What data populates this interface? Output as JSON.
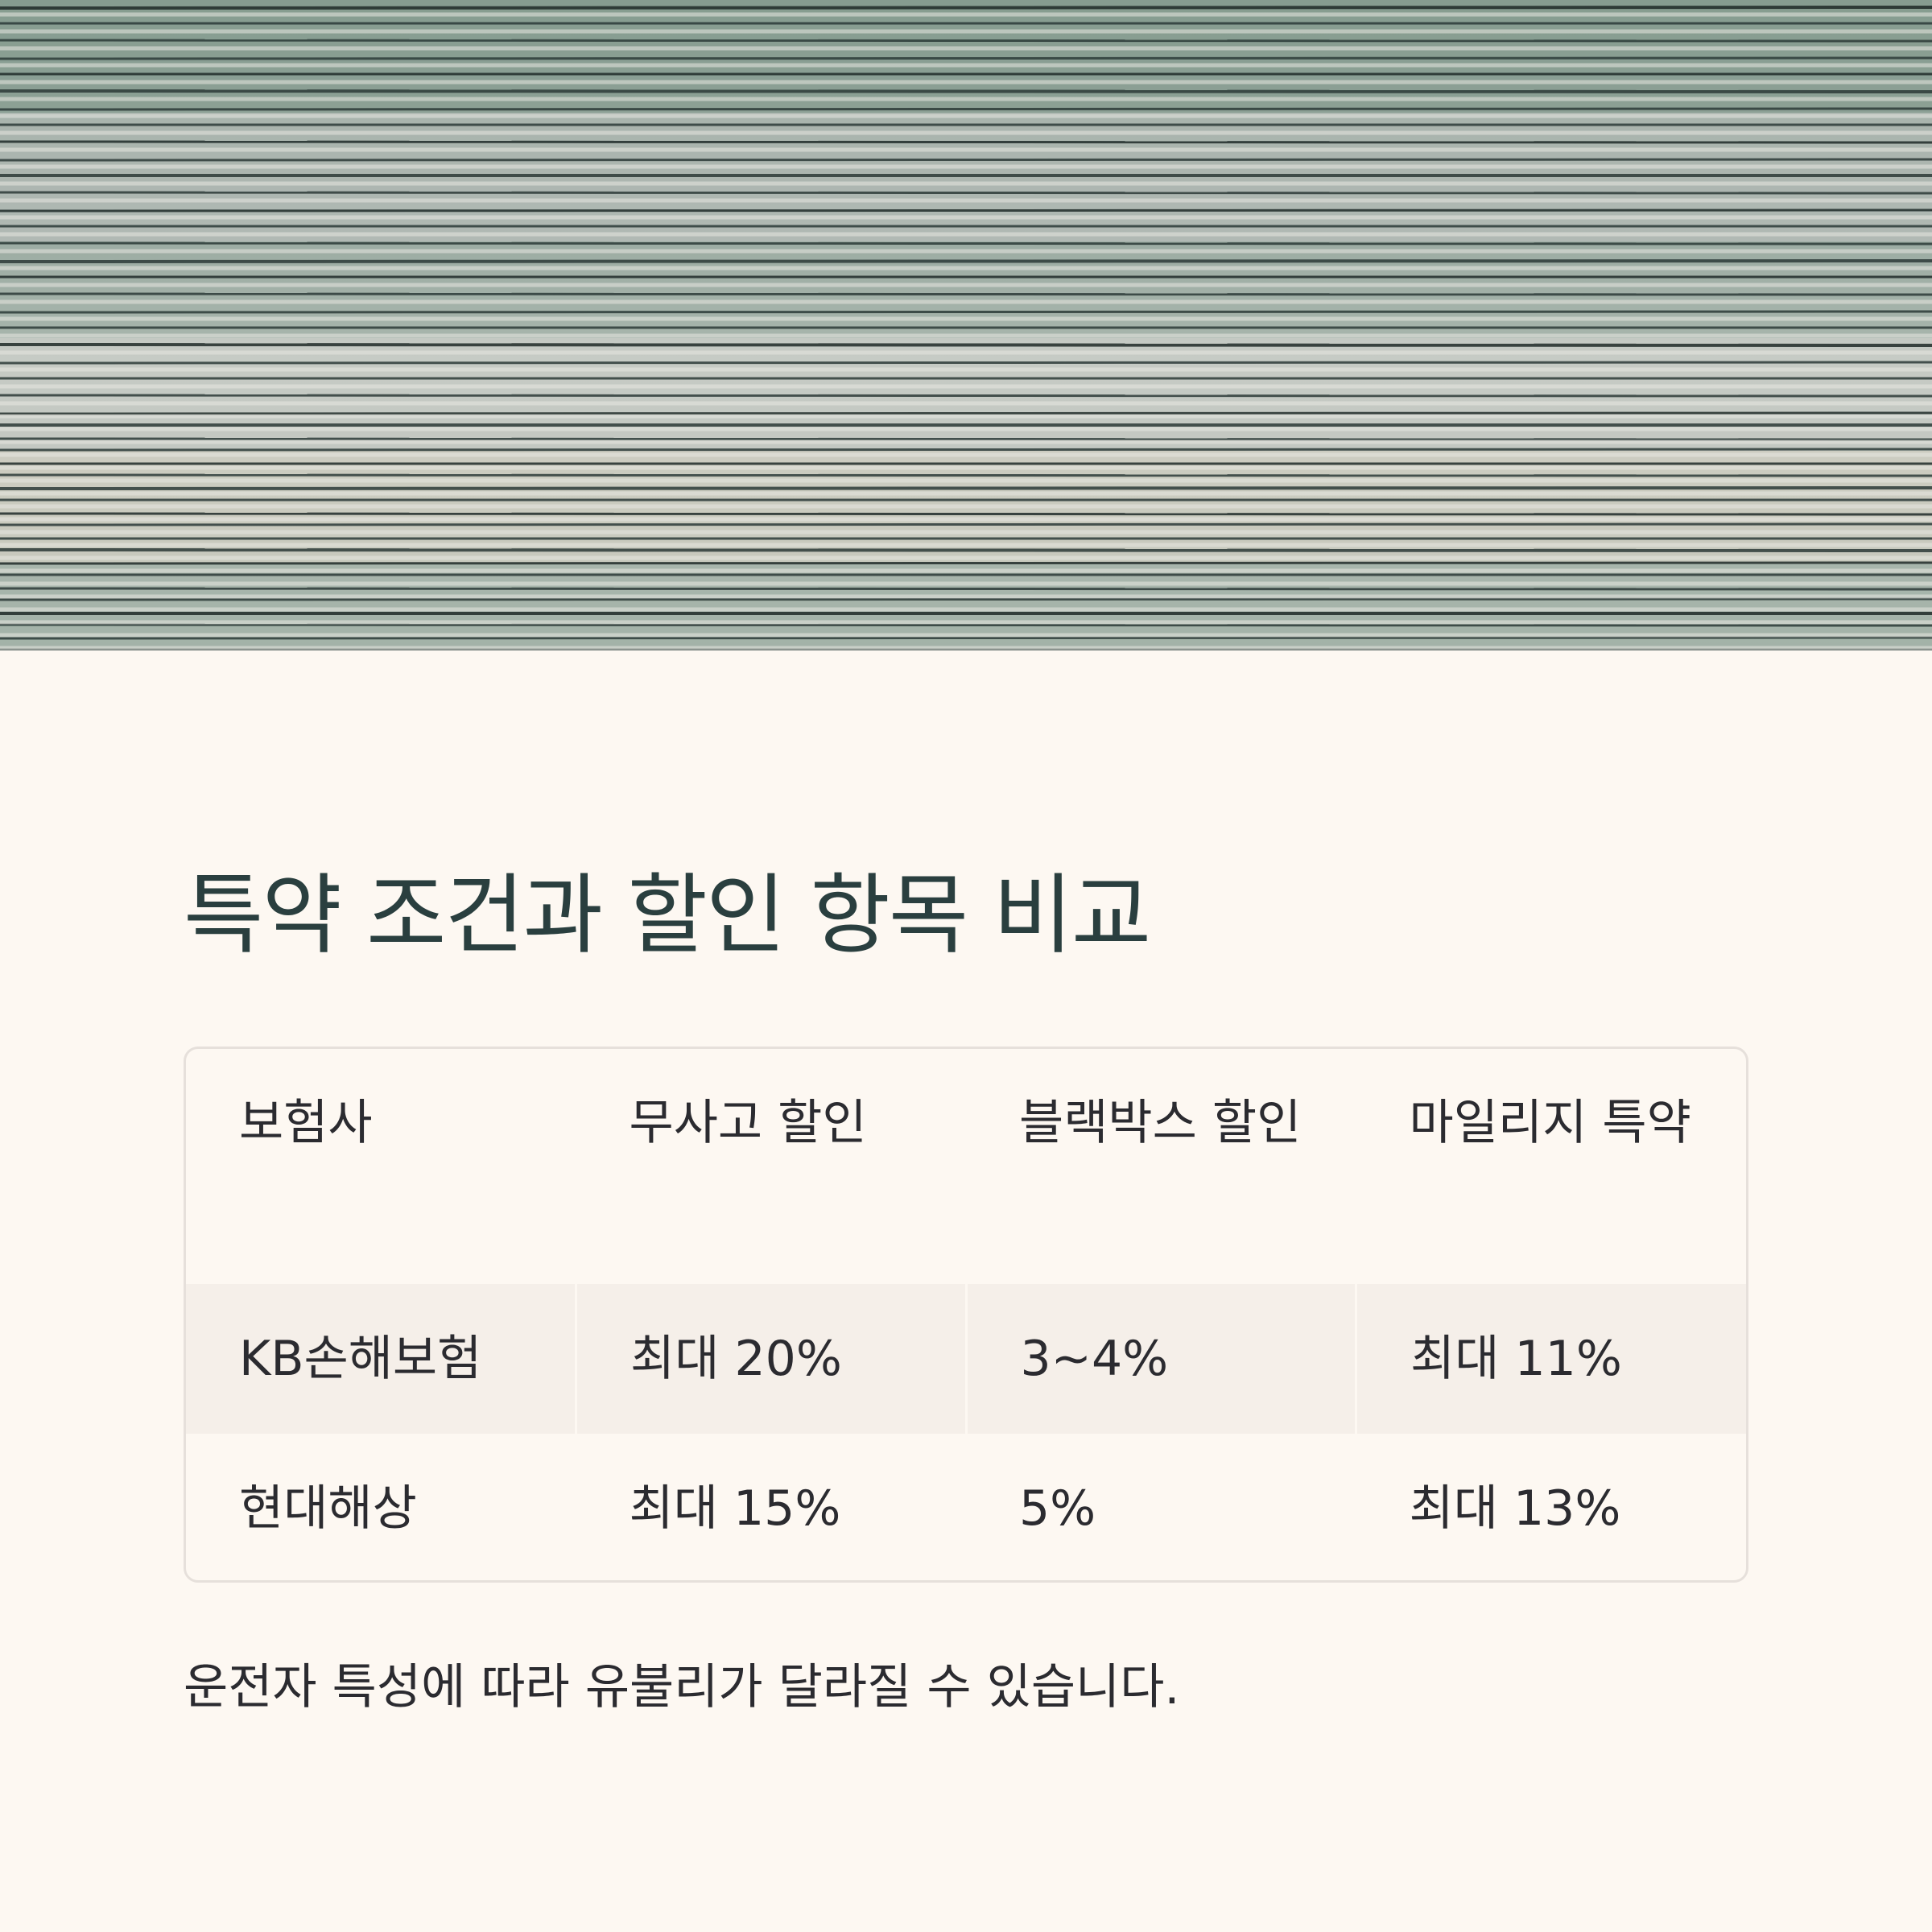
{
  "title": "특약 조건과 할인 항목 비교",
  "table": {
    "headers": [
      "보험사",
      "무사고 할인",
      "블랙박스 할인",
      "마일리지 특약"
    ],
    "rows": [
      [
        "KB손해보험",
        "최대 20%",
        "3~4%",
        "최대 11%"
      ],
      [
        "현대해상",
        "최대 15%",
        "5%",
        "최대 13%"
      ]
    ]
  },
  "note": "운전자 특성에 따라 유불리가 달라질 수 있습니다.",
  "colors": {
    "background": "#fdf8f2",
    "title": "#2a3f3f",
    "alt_row": "#f5efe9",
    "border": "#e6e0db"
  }
}
